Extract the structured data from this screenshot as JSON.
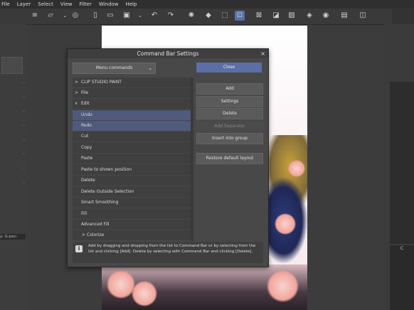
{
  "menubar": {
    "items": [
      "File",
      "Layer",
      "Select",
      "View",
      "Filter",
      "Window",
      "Help"
    ]
  },
  "toolbar": {
    "icons": [
      "hamburger-icon",
      "new-file-icon",
      "chevron-down-icon",
      "clip-studio-icon",
      "page-icon",
      "folder-icon",
      "save-icon",
      "chevron-down-icon",
      "undo-icon",
      "redo-icon",
      "lasso-icon",
      "fill-icon",
      "crop-icon",
      "select-transform-icon",
      "deselect-icon",
      "invert-icon",
      "clear-icon",
      "fill-layer-icon",
      "note-icon",
      "note2-icon",
      "settings-icon"
    ]
  },
  "dialog": {
    "title": "Command Bar Settings",
    "close_x": "×",
    "dropdown_value": "Menu commands",
    "close_button": "Close",
    "list": [
      {
        "label": "CLIP STUDIO PAINT",
        "chevron": ">",
        "selected": false
      },
      {
        "label": "File",
        "chevron": ">",
        "selected": false
      },
      {
        "label": "Edit",
        "chevron": "∨",
        "selected": false
      },
      {
        "label": "Undo",
        "chevron": "",
        "selected": true
      },
      {
        "label": "Redo",
        "chevron": "",
        "selected": true
      },
      {
        "label": "Cut",
        "chevron": "",
        "selected": false
      },
      {
        "label": "Copy",
        "chevron": "",
        "selected": false
      },
      {
        "label": "Paste",
        "chevron": "",
        "selected": false
      },
      {
        "label": "Paste to shown position",
        "chevron": "",
        "selected": false
      },
      {
        "label": "Delete",
        "chevron": "",
        "selected": false
      },
      {
        "label": "Delete Outside Selection",
        "chevron": "",
        "selected": false
      },
      {
        "label": "Smart Smoothing",
        "chevron": "",
        "selected": false
      },
      {
        "label": "Fill",
        "chevron": "",
        "selected": false
      },
      {
        "label": "Advanced Fill",
        "chevron": "",
        "selected": false
      },
      {
        "label": "Colorize",
        "chevron": ">",
        "selected": false
      }
    ],
    "buttons": {
      "add": "Add",
      "settings": "Settings",
      "delete": "Delete",
      "add_separator": "Add Separator",
      "insert_group": "Insert into group",
      "restore": "Restore default layout"
    },
    "info_text": "Add by dragging and dropping from the list to Command Bar or by selecting from the list and clicking [Add]. Delete by selecting with Command Bar and clicking [Delete]."
  },
  "left_panel": {
    "tool_label": "y: G-pen"
  },
  "right_panel": {
    "label": "C"
  }
}
